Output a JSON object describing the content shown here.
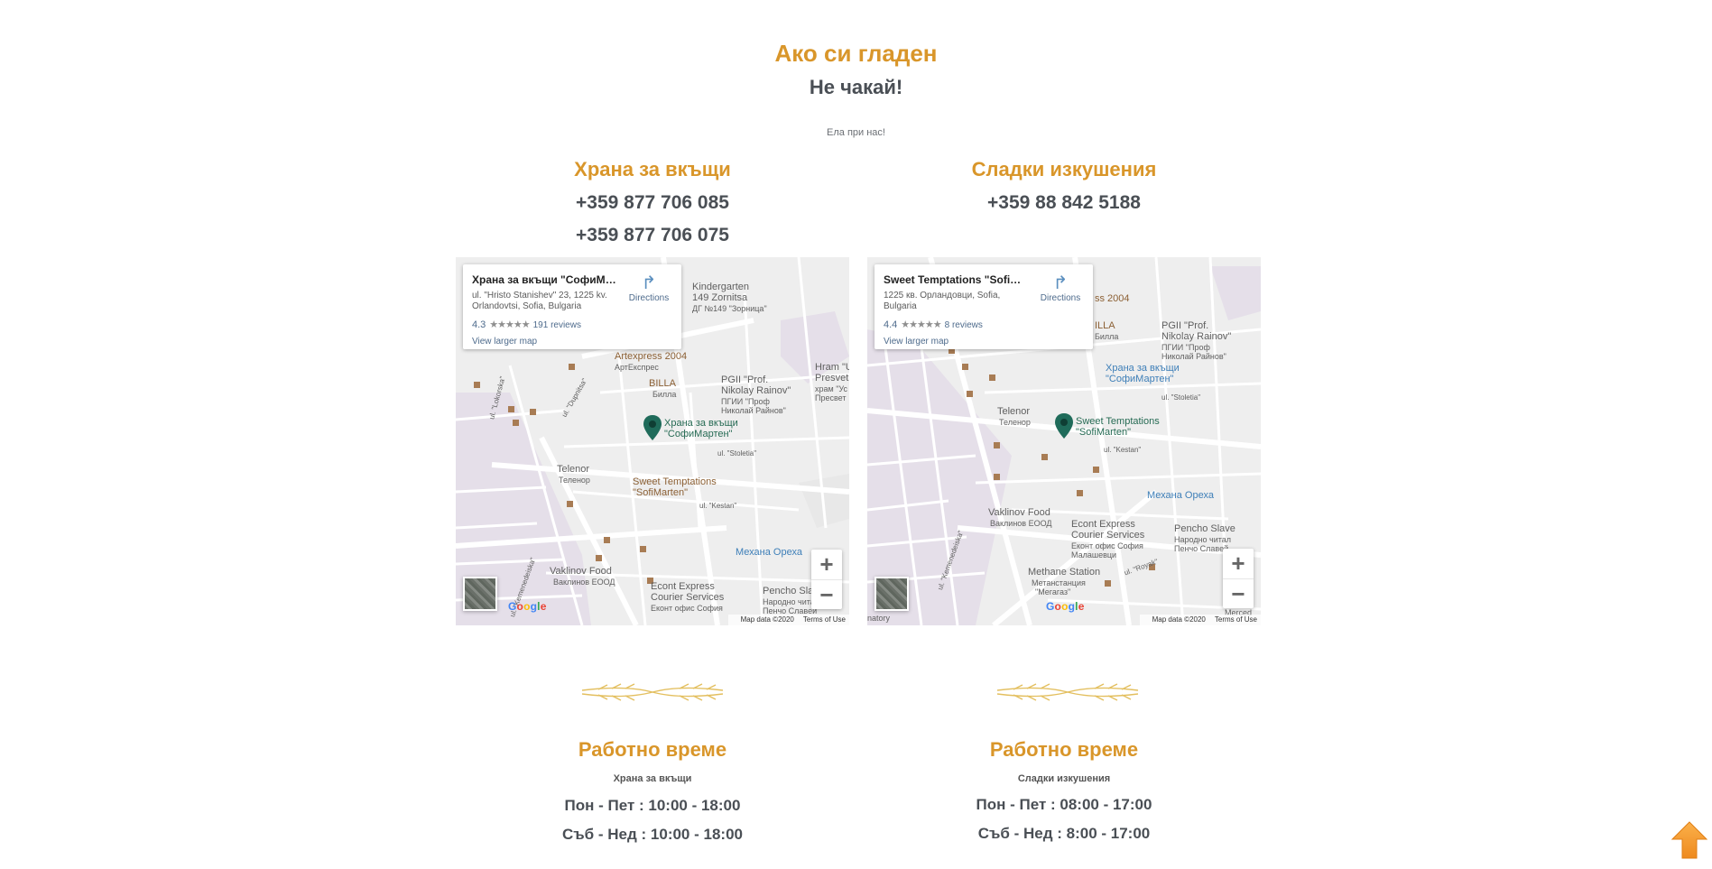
{
  "hero": {
    "title": "Ако си гладен",
    "subtitle": "Не чакай!",
    "note": "Ела при нас!"
  },
  "left": {
    "title": "Храна за вкъщи",
    "phones": [
      "+359 877 706 085",
      "+359 877 706 075"
    ],
    "map": {
      "card_title": "Храна за вкъщи \"СофиМарт...",
      "card_address": "ul. \"Hristo Stanishev\" 23, 1225 kv. Orlandovtsi, Sofia, Bulgaria",
      "rating": "4.3",
      "stars": "★★★★★",
      "reviews": "191 reviews",
      "view_larger": "View larger map",
      "directions": "Directions",
      "zoom_in": "+",
      "zoom_out": "−",
      "google": "Google",
      "map_data": "Map data ©2020",
      "terms": "Terms of Use",
      "labels": {
        "kindergarten": "Kindergarten",
        "kindergarten2": "149 Zornitsa",
        "kindergarten3": "ДГ №149 \"Зорница\"",
        "artexpress": "Artexpress 2004",
        "artexpress_bg": "АртЕкспрес",
        "billa": "BILLA",
        "billa_bg": "Билла",
        "pgii": "PGII \"Prof.",
        "pgii2": "Nikolay Rainov\"",
        "pgii3": "ПГИИ \"Проф",
        "pgii4": "Николай Райнов\"",
        "hram": "Hram \"U",
        "hram2": "Presvet",
        "hram3": "храм \"Ус",
        "hram4": "Пресвет",
        "marker1": "Храна за вкъщи",
        "marker2": "\"СофиМартен\"",
        "telenor": "Telenor",
        "telenor_bg": "Теленор",
        "sweet": "Sweet Temptations",
        "sweet2": "\"SofiMarten\"",
        "mehana": "Механа Ореха",
        "vaklinov": "Vaklinov Food",
        "vaklinov_bg": "Ваклинов ЕООД",
        "econt": "Econt Express",
        "econt2": "Courier Services",
        "econt3": "Еконт офис София",
        "pencho": "Pencho Sla",
        "pencho2": "Народно чита",
        "pencho3": "Пенчо Славей",
        "street1": "ul. \"Lokorska\"",
        "street2": "ul. \"Dupnitsa\"",
        "street3": "ul. \"Stoletia\"",
        "street4": "ul. \"Kestan\"",
        "street5": "ul. \"Kemenedeiska\""
      }
    },
    "hours_title": "Работно време",
    "hours_sub": "Храна за вкъщи",
    "hours": [
      "Пон - Пет : 10:00 - 18:00",
      "Съб - Нед : 10:00 - 18:00"
    ]
  },
  "right": {
    "title": "Сладки изкушения",
    "phones": [
      "+359 88 842 5188"
    ],
    "map": {
      "card_title": "Sweet Temptations \"SofiMart...",
      "card_address": "1225 кв. Орландовци, Sofia, Bulgaria",
      "rating": "4.4",
      "stars": "★★★★★",
      "reviews": "8 reviews",
      "view_larger": "View larger map",
      "directions": "Directions",
      "zoom_in": "+",
      "zoom_out": "−",
      "google": "Google",
      "map_data": "Map data ©2020",
      "terms": "Terms of Use",
      "labels": {
        "artexpress": "ss 2004",
        "billa": "ILLA",
        "billa_bg": "Билла",
        "pgii": "PGII \"Prof.",
        "pgii2": "Nikolay Rainov\"",
        "pgii3": "ПГИИ \"Проф",
        "pgii4": "Николай Райнов\"",
        "food": "Храна за вкъщи",
        "food2": "\"СофиМартен\"",
        "telenor": "Telenor",
        "telenor_bg": "Теленор",
        "marker1": "Sweet Temptations",
        "marker2": "\"SofiMarten\"",
        "mehana": "Механа Ореха",
        "vaklinov": "Vaklinov Food",
        "vaklinov_bg": "Ваклинов ЕООД",
        "econt": "Econt Express",
        "econt2": "Courier Services",
        "econt3": "Еконт офис София",
        "econt4": "Малашевци",
        "pencho": "Pencho Slave",
        "pencho2": "Народно читал",
        "pencho3": "Пенчо Славей",
        "methane": "Methane Station",
        "methane2": "Метанстанция",
        "methane3": "\"Мегагаз\"",
        "mercedes": "Merced",
        "natory": "natory",
        "street1": "ul. \"Kemenedeiska\"",
        "street2": "ul. \"Stoletia\"",
        "street3": "ul. \"Kestan\"",
        "street4": "ul. \"Royak\""
      }
    },
    "hours_title": "Работно време",
    "hours_sub": "Сладки изкушения",
    "hours": [
      "Пон - Пет : 08:00 - 17:00",
      "Съб - Нед : 8:00 - 17:00"
    ]
  },
  "colors": {
    "accent": "#d9962a",
    "text": "#4a4f55",
    "scroll_top": "#f39a2b"
  },
  "scroll_top_icon": "arrow-up-icon"
}
